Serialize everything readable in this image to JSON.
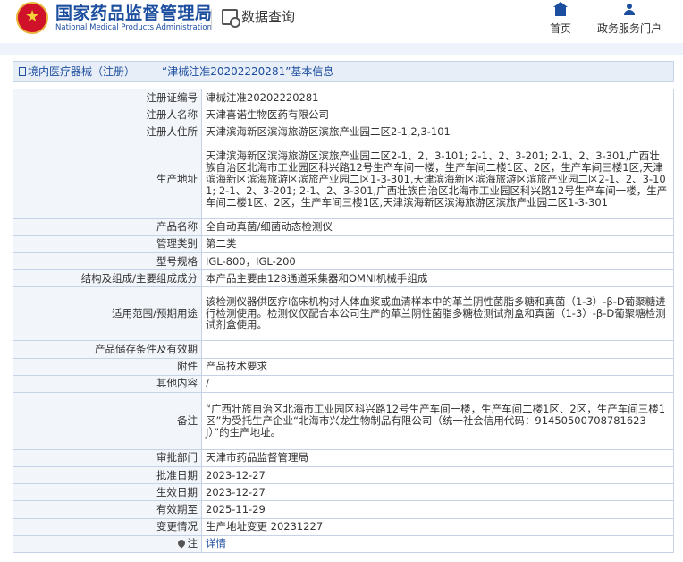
{
  "header": {
    "site_title_cn": "国家药品监督管理局",
    "site_title_en": "National Medical Products Administration",
    "data_query": "数据查询",
    "nav": {
      "home": "首页",
      "portal": "政务服务门户"
    }
  },
  "breadcrumb": {
    "section": "境内医疗器械（注册）",
    "separator": "——",
    "record": "“津械注准20202220281”基本信息"
  },
  "record": {
    "rows": [
      {
        "label": "注册证编号",
        "value": "津械注准20202220281"
      },
      {
        "label": "注册人名称",
        "value": "天津喜诺生物医药有限公司"
      },
      {
        "label": "注册人住所",
        "value": "天津滨海新区滨海旅游区滨旅产业园二区2-1,2,3-101"
      },
      {
        "label": "生产地址",
        "value": "天津滨海新区滨海旅游区滨旅产业园二区2-1、2、3-101; 2-1、2、3-201; 2-1、2、3-301,广西壮族自治区北海市工业园区科兴路12号生产车间一楼，生产车间二楼1区、2区，生产车间三楼1区,天津滨海新区滨海旅游区滨旅产业园二区1-3-301,天津滨海新区滨海旅游区滨旅产业园二区2-1、2、3-101; 2-1、2、3-201; 2-1、2、3-301,广西壮族自治区北海市工业园区科兴路12号生产车间一楼，生产车间二楼1区、2区，生产车间三楼1区,天津滨海新区滨海旅游区滨旅产业园二区1-3-301"
      },
      {
        "label": "产品名称",
        "value": "全自动真菌/细菌动态检测仪"
      },
      {
        "label": "管理类别",
        "value": "第二类"
      },
      {
        "label": "型号规格",
        "value": "IGL-800，IGL-200"
      },
      {
        "label": "结构及组成/主要组成成分",
        "value": "本产品主要由128通道采集器和OMNI机械手组成"
      },
      {
        "label": "适用范围/预期用途",
        "value": "该检测仪器供医疗临床机构对人体血浆或血清样本中的革兰阴性菌脂多糖和真菌（1-3）-β-D葡聚糖进行检测使用。检测仪仅配合本公司生产的革兰阴性菌脂多糖检测试剂盒和真菌（1-3）-β-D葡聚糖检测试剂盒使用。"
      },
      {
        "label": "产品储存条件及有效期",
        "value": ""
      },
      {
        "label": "附件",
        "value": "产品技术要求"
      },
      {
        "label": "其他内容",
        "value": "/"
      },
      {
        "label": "备注",
        "value": "“广西壮族自治区北海市工业园区科兴路12号生产车间一楼，生产车间二楼1区、2区，生产车间三楼1区”为受托生产企业“北海市兴龙生物制品有限公司（统一社会信用代码：91450500708781623J）”的生产地址。"
      },
      {
        "label": "审批部门",
        "value": "天津市药品监督管理局"
      },
      {
        "label": "批准日期",
        "value": "2023-12-27"
      },
      {
        "label": "生效日期",
        "value": "2023-12-27"
      },
      {
        "label": "有效期至",
        "value": "2025-11-29"
      },
      {
        "label": "变更情况",
        "value": "生产地址变更 20231227"
      }
    ],
    "note_row": {
      "label": "注",
      "value": "详情"
    }
  }
}
